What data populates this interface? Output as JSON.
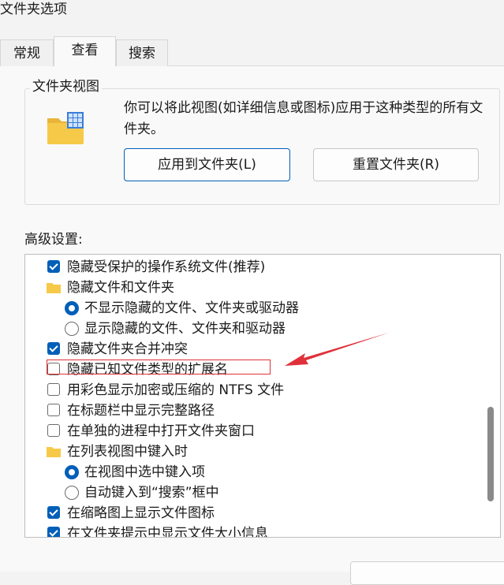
{
  "window": {
    "title": "文件夹选项"
  },
  "tabs": [
    {
      "label": "常规",
      "active": false
    },
    {
      "label": "查看",
      "active": true
    },
    {
      "label": "搜索",
      "active": false
    }
  ],
  "folder_views": {
    "group_label": "文件夹视图",
    "description": "你可以将此视图(如详细信息或图标)应用于这种类型的所有文件夹。",
    "apply_button": "应用到文件夹(L)",
    "reset_button": "重置文件夹(R)"
  },
  "advanced": {
    "label": "高级设置:",
    "items": [
      {
        "type": "checkbox",
        "checked": true,
        "label": "隐藏受保护的操作系统文件(推荐)"
      },
      {
        "type": "folder",
        "label": "隐藏文件和文件夹"
      },
      {
        "type": "radio",
        "checked": true,
        "label": "不显示隐藏的文件、文件夹或驱动器"
      },
      {
        "type": "radio",
        "checked": false,
        "label": "显示隐藏的文件、文件夹和驱动器"
      },
      {
        "type": "checkbox",
        "checked": true,
        "label": "隐藏文件夹合并冲突"
      },
      {
        "type": "checkbox",
        "checked": false,
        "label": "隐藏已知文件类型的扩展名"
      },
      {
        "type": "checkbox",
        "checked": false,
        "label": "用彩色显示加密或压缩的 NTFS 文件"
      },
      {
        "type": "checkbox",
        "checked": false,
        "label": "在标题栏中显示完整路径"
      },
      {
        "type": "checkbox",
        "checked": false,
        "label": "在单独的进程中打开文件夹窗口"
      },
      {
        "type": "folder",
        "label": "在列表视图中键入时"
      },
      {
        "type": "radio",
        "checked": true,
        "label": "在视图中选中键入项"
      },
      {
        "type": "radio",
        "checked": false,
        "label": "自动键入到“搜索”框中"
      },
      {
        "type": "checkbox",
        "checked": true,
        "label": "在缩略图上显示文件图标"
      },
      {
        "type": "checkbox",
        "checked": true,
        "label": "在文件夹提示中显示文件大小信息"
      }
    ]
  },
  "colors": {
    "accent": "#005fb8",
    "annotation": "#e0303a",
    "folder": "#f7c948"
  }
}
